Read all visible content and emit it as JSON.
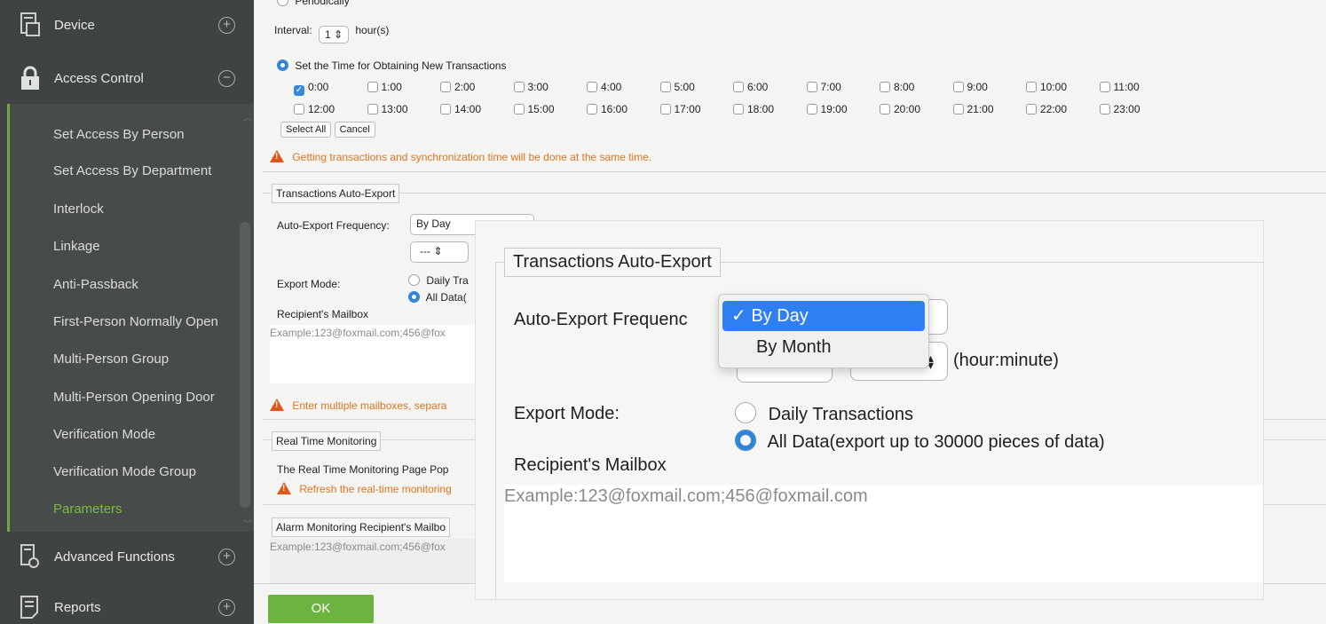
{
  "sidebar": {
    "device": "Device",
    "access_control": "Access Control",
    "items": [
      "Set Access By Person",
      "Set Access By Department",
      "Interlock",
      "Linkage",
      "Anti-Passback",
      "First-Person Normally Open",
      "Multi-Person Group",
      "Multi-Person Opening Door",
      "Verification Mode",
      "Verification Mode Group",
      "Parameters"
    ],
    "advanced": "Advanced Functions",
    "reports": "Reports",
    "plus": "+",
    "minus": "−"
  },
  "main": {
    "periodically": "Periodically",
    "interval_label": "Interval:",
    "interval_value": "1",
    "interval_unit": "hour(s)",
    "set_time_label": "Set the Time for Obtaining New Transactions",
    "times_row1": [
      "0:00",
      "1:00",
      "2:00",
      "3:00",
      "4:00",
      "5:00",
      "6:00",
      "7:00",
      "8:00",
      "9:00",
      "10:00",
      "11:00"
    ],
    "times_row2": [
      "12:00",
      "13:00",
      "14:00",
      "15:00",
      "16:00",
      "17:00",
      "18:00",
      "19:00",
      "20:00",
      "21:00",
      "22:00",
      "23:00"
    ],
    "select_all": "Select All",
    "cancel": "Cancel",
    "warn_sync": "Getting transactions and synchronization time will be done at the same time.",
    "auto_export_legend": "Transactions Auto-Export",
    "auto_export_freq_label": "Auto-Export Frequency:",
    "auto_export_freq_value": "By Day",
    "dash_value": "---",
    "export_mode_label": "Export Mode:",
    "daily_tra": "Daily Tra",
    "all_data": "All Data(",
    "recipient_label": "Recipient's Mailbox",
    "mail_placeholder_cut": "Example:123@foxmail.com;456@fox",
    "warn_mailboxes": "Enter multiple mailboxes, separa",
    "rtm_legend": "Real Time Monitoring",
    "rtm_text": "The Real Time Monitoring Page Pop",
    "rtm_warn": "Refresh the real-time monitoring",
    "alarm_legend": "Alarm Monitoring Recipient's Mailbo",
    "alarm_placeholder_cut": "Example:123@foxmail.com;456@fox",
    "ok": "OK"
  },
  "zoom": {
    "legend": "Transactions Auto-Export",
    "freq_label": "Auto-Export Frequenc",
    "hour_minute": "(hour:minute)",
    "export_mode_label": "Export Mode:",
    "daily": "Daily Transactions",
    "all_data": "All Data(export up to 30000 pieces of data)",
    "recipient": "Recipient's Mailbox",
    "mail_placeholder": "Example:123@foxmail.com;456@foxmail.com",
    "dropdown": {
      "selected_mark": "✓",
      "options": [
        "By Day",
        "By Month"
      ]
    }
  }
}
